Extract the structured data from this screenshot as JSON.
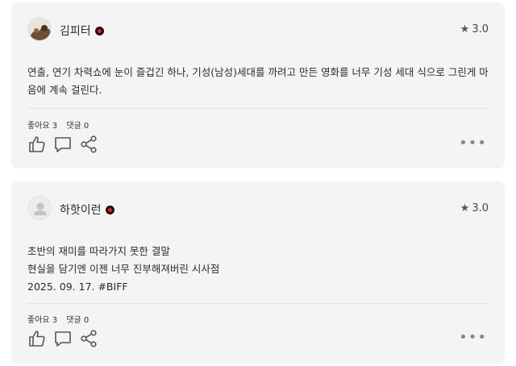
{
  "reviews": [
    {
      "username": "김피터",
      "rating": "3.0",
      "text_lines": [
        "연출, 연기 차력쇼에 눈이 즐겁긴 하나, 기성(남성)세대를 까려고 만든 영화를 너무 기성 세대 식으로 그린게 마",
        "음에 계속 걸린다."
      ],
      "likes": "좋아요 3",
      "comments": "댓글 0"
    },
    {
      "username": "하핫이런",
      "rating": "3.0",
      "text_lines": [
        "초반의 재미를 따라가지 못한 결말",
        "현실을 담기엔 이젠 너무 진부해져버린 시사점",
        "2025. 09. 17. #BIFF"
      ],
      "likes": "좋아요 3",
      "comments": "댓글 0"
    }
  ],
  "icons": {
    "rating": "star-icon",
    "like": "thumbs-up-icon",
    "comment": "comment-bubble-icon",
    "share": "share-icon",
    "more": "more-dots-icon",
    "badge": "verified-badge-icon"
  }
}
